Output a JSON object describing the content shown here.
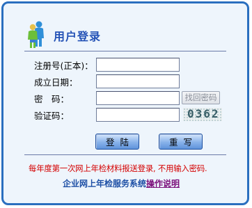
{
  "header": {
    "title": "用户登录",
    "icon": "users-icon"
  },
  "form": {
    "reg_no_label": "注册号(正本)：",
    "reg_no_value": "",
    "date_label": "成立日期：",
    "date_value": "",
    "password_label": "密　码：",
    "password_value": "",
    "recover_label": "找回密码",
    "captcha_label": "验证码：",
    "captcha_value": "",
    "captcha_code": "0362"
  },
  "buttons": {
    "login_label": "登陆",
    "reset_label": "重写"
  },
  "notice": "每年度第一次网上年检材料报送登录, 不用输入密码.",
  "footer": {
    "text": "企业网上年检服务系统",
    "link": "操作说明"
  },
  "colors": {
    "border": "#2a6fbf",
    "panel_bg": "#eef5fc",
    "title": "#2452b6",
    "notice": "#d40000",
    "link": "#7b0f7b"
  }
}
